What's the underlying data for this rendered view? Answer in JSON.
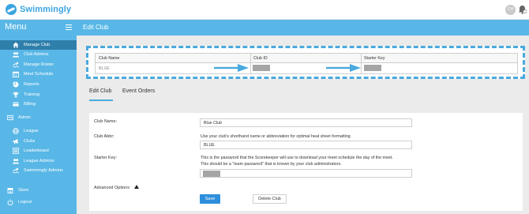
{
  "app": {
    "name": "Swimmingly"
  },
  "user": {
    "initials": "CH"
  },
  "sidebar": {
    "title": "Menu",
    "items": [
      {
        "label": "Manage Club",
        "icon": "home-icon",
        "active": true
      },
      {
        "label": "Club Admins",
        "icon": "users-icon"
      },
      {
        "label": "Manage Roster",
        "icon": "swimmer-icon"
      },
      {
        "label": "Meet Schedule",
        "icon": "calendar-icon"
      },
      {
        "label": "Reports",
        "icon": "pie-chart-icon"
      },
      {
        "label": "Training",
        "icon": "trophy-icon"
      },
      {
        "label": "Billing",
        "icon": "credit-card-icon"
      },
      {
        "label": "Admin",
        "icon": "id-card-icon"
      },
      {
        "label": "League",
        "icon": "globe-icon"
      },
      {
        "label": "Clubs",
        "icon": "megaphone-icon"
      },
      {
        "label": "Leaderboard",
        "icon": "list-icon"
      },
      {
        "label": "League Admins",
        "icon": "users-icon"
      },
      {
        "label": "Swimmingly Admins",
        "icon": "swimmer-icon"
      },
      {
        "label": "Store",
        "icon": "store-icon"
      },
      {
        "label": "Logout",
        "icon": "power-icon"
      }
    ]
  },
  "page": {
    "title": "Edit Club"
  },
  "summary_table": {
    "columns": [
      "Club Name",
      "Club ID",
      "Starter Key"
    ],
    "row": {
      "club_name": "BLUE",
      "club_id": "",
      "starter_key": ""
    }
  },
  "tabs": [
    {
      "label": "Edit Club",
      "active": true
    },
    {
      "label": "Event Orders",
      "active": false
    }
  ],
  "form": {
    "club_name_label": "Club Name:",
    "club_name_value": "Blue Club",
    "club_abbr_label": "Club Abbr:",
    "club_abbr_help": "Use your club's shorthand name or abbreviation for optimal heat sheet formatting",
    "club_abbr_value": "BLUE",
    "starter_key_label": "Starter Key:",
    "starter_key_help_1": "This is the password that the Scorekeeper will use to download your meet schedule the day of the meet.",
    "starter_key_help_2": "This should be a \"team password\" that is known by your club administrators.",
    "advanced_label": "Advanced Options",
    "save_label": "Save",
    "delete_label": "Delete Club"
  },
  "colors": {
    "brand": "#3aa4e0",
    "sidebar": "#58b7e6",
    "sidebar_active": "#2f7fab",
    "highlight": "#4aa9dd",
    "primary_button": "#2d8fdc"
  }
}
